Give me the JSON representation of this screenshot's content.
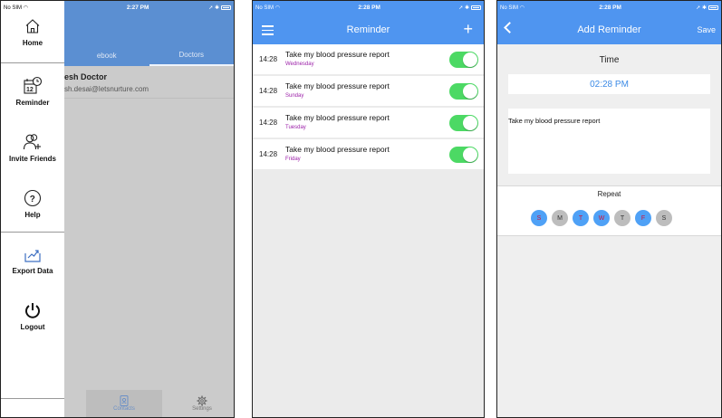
{
  "screen1": {
    "status": {
      "carrier": "No SIM",
      "time": "2:27 PM"
    },
    "tabs": [
      "ebook",
      "Doctors"
    ],
    "contact": {
      "name": "esh Doctor",
      "email": "sh.desai@letsnurture.com"
    },
    "menu": {
      "home": "Home",
      "reminder": "Reminder",
      "invite": "Invite Friends",
      "help": "Help",
      "export": "Export Data",
      "logout": "Logout"
    },
    "bottom_tabs": {
      "contacts": "Contacts",
      "settings": "Settings"
    }
  },
  "screen2": {
    "status": {
      "carrier": "No SIM",
      "time": "2:28 PM"
    },
    "title": "Reminder",
    "add_label": "+",
    "reminders": [
      {
        "time": "14:28",
        "text": "Take my blood pressure report",
        "day": "Wednesday"
      },
      {
        "time": "14:28",
        "text": "Take my blood pressure report",
        "day": "Sunday"
      },
      {
        "time": "14:28",
        "text": "Take my blood pressure report",
        "day": "Tuesday"
      },
      {
        "time": "14:28",
        "text": "Take my blood pressure report",
        "day": "Friday"
      }
    ]
  },
  "screen3": {
    "status": {
      "carrier": "No SIM",
      "time": "2:28 PM"
    },
    "title": "Add Reminder",
    "save_label": "Save",
    "time_label": "Time",
    "time_value": "02:28 PM",
    "note": "Take my blood pressure report",
    "repeat_label": "Repeat",
    "days": [
      {
        "letter": "S",
        "selected": true
      },
      {
        "letter": "M",
        "selected": false
      },
      {
        "letter": "T",
        "selected": true
      },
      {
        "letter": "W",
        "selected": true
      },
      {
        "letter": "T",
        "selected": false
      },
      {
        "letter": "F",
        "selected": true
      },
      {
        "letter": "S",
        "selected": false
      }
    ]
  },
  "colors": {
    "nav_blue": "#4f95f0",
    "toggle_green": "#4cd964",
    "day_purple": "#9b1fa8",
    "selected_day": "#4fa1f6"
  }
}
